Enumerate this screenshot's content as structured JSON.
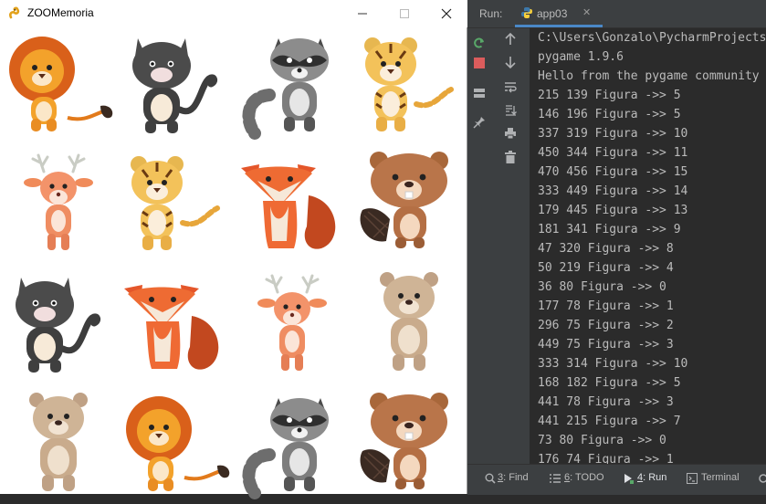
{
  "pygame_window": {
    "title": "ZOOMemoria",
    "icon": "pygame-snake-icon",
    "controls": [
      "minimize-icon",
      "maximize-icon",
      "close-icon"
    ],
    "cards": [
      [
        "lion",
        "cat",
        "raccoon",
        "tiger"
      ],
      [
        "deer",
        "tiger",
        "fox",
        "beaver"
      ],
      [
        "cat",
        "fox",
        "deer",
        "bear"
      ],
      [
        "bear",
        "lion",
        "raccoon",
        "beaver"
      ]
    ]
  },
  "run_panel": {
    "label": "Run:",
    "tab_name": "app03",
    "console_lines": [
      "C:\\Users\\Gonzalo\\PycharmProjects",
      "pygame 1.9.6",
      "Hello from the pygame community",
      "215 139 Figura ->> 5",
      "146 196 Figura ->> 5",
      "337 319 Figura ->> 10",
      "450 344 Figura ->> 11",
      "470 456 Figura ->> 15",
      "333 449 Figura ->> 14",
      "179 445 Figura ->> 13",
      "181 341 Figura ->> 9",
      "47 320 Figura ->> 8",
      "50 219 Figura ->> 4",
      "36 80 Figura ->> 0",
      "177 78 Figura ->> 1",
      "296 75 Figura ->> 2",
      "449 75 Figura ->> 3",
      "333 314 Figura ->> 10",
      "168 182 Figura ->> 5",
      "441 78 Figura ->> 3",
      "441 215 Figura ->> 7",
      "73 80 Figura ->> 0",
      "176 74 Figura ->> 1"
    ],
    "bottom_tabs": [
      {
        "key": "3",
        "label": ": Find"
      },
      {
        "key": "6",
        "label": ": TODO"
      },
      {
        "key": "4",
        "label": ": Run"
      },
      {
        "key": "",
        "label": "Terminal"
      }
    ],
    "colors": {
      "accent": "#4a88c7",
      "console_text": "#bbbbbb",
      "background": "#2b2b2b"
    }
  }
}
